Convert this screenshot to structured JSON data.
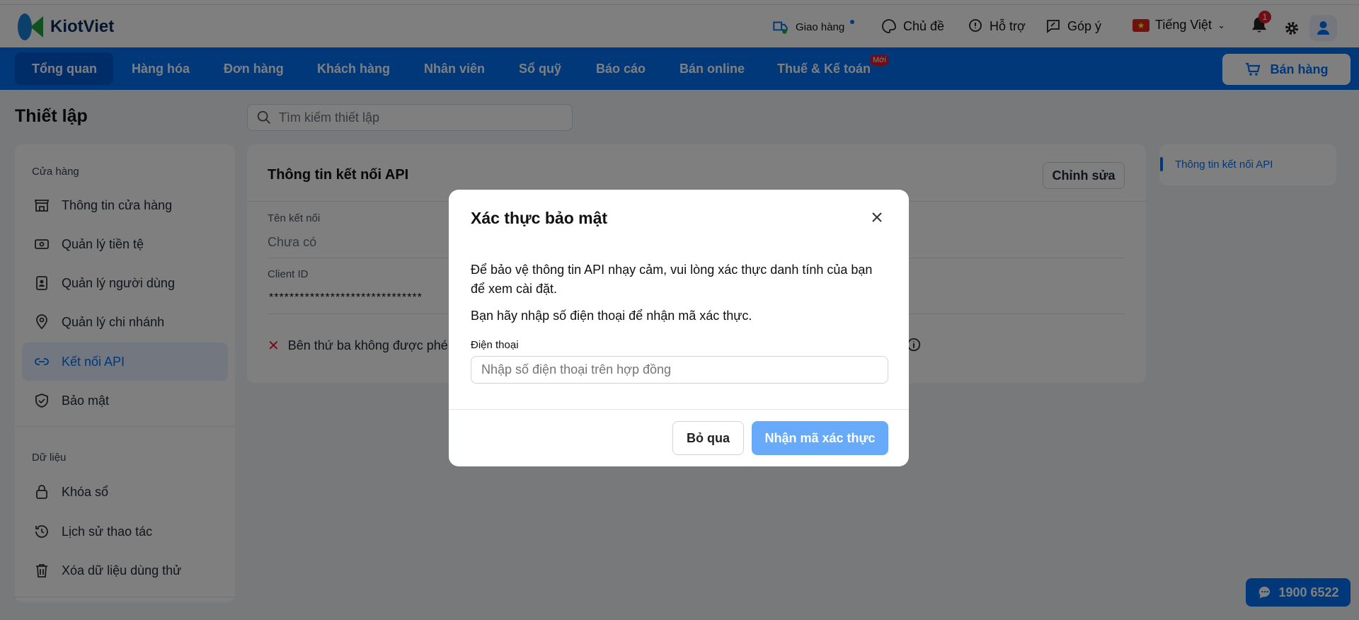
{
  "header": {
    "brand": "KiotViet",
    "delivery": "Giao hàng",
    "theme": "Chủ đề",
    "support": "Hỗ trợ",
    "feedback": "Góp ý",
    "language": "Tiếng Việt",
    "notification_count": "1"
  },
  "nav": {
    "items": [
      "Tổng quan",
      "Hàng hóa",
      "Đơn hàng",
      "Khách hàng",
      "Nhân viên",
      "Sổ quỹ",
      "Báo cáo",
      "Bán online",
      "Thuế & Kế toán"
    ],
    "new_badge": "Mới",
    "sell_button": "Bán hàng",
    "accent": "#0070f4"
  },
  "page": {
    "title": "Thiết lập",
    "search_placeholder": "Tìm kiếm thiết lập"
  },
  "sidebar": {
    "store_heading": "Cửa hàng",
    "store_items": [
      "Thông tin cửa hàng",
      "Quản lý tiền tệ",
      "Quản lý người dùng",
      "Quản lý chi nhánh",
      "Kết nối API",
      "Bảo mật"
    ],
    "data_heading": "Dữ liệu",
    "data_items": [
      "Khóa sổ",
      "Lịch sử thao tác",
      "Xóa dữ liệu dùng thử"
    ]
  },
  "main": {
    "title": "Thông tin kết nối API",
    "edit_button": "Chỉnh sửa",
    "connection_name_label": "Tên kết nối",
    "connection_name_value": "Chưa có",
    "client_id_label": "Client ID",
    "client_id_value": "******************************",
    "third_party_text": "Bên thứ ba không được phé"
  },
  "toc": {
    "item": "Thông tin kết nối API"
  },
  "modal": {
    "title": "Xác thực bảo mật",
    "desc1": "Để bảo vệ thông tin API nhạy cảm, vui lòng xác thực danh tính của bạn",
    "desc2": "để xem cài đặt.",
    "desc3": "Bạn hãy nhập số điện thoại để nhận mã xác thực.",
    "phone_label": "Điện thoại",
    "phone_placeholder": "Nhập số điện thoại trên hợp đồng",
    "phone_value": "",
    "cancel": "Bỏ qua",
    "submit": "Nhận mã xác thực"
  },
  "hotline": "1900 6522"
}
